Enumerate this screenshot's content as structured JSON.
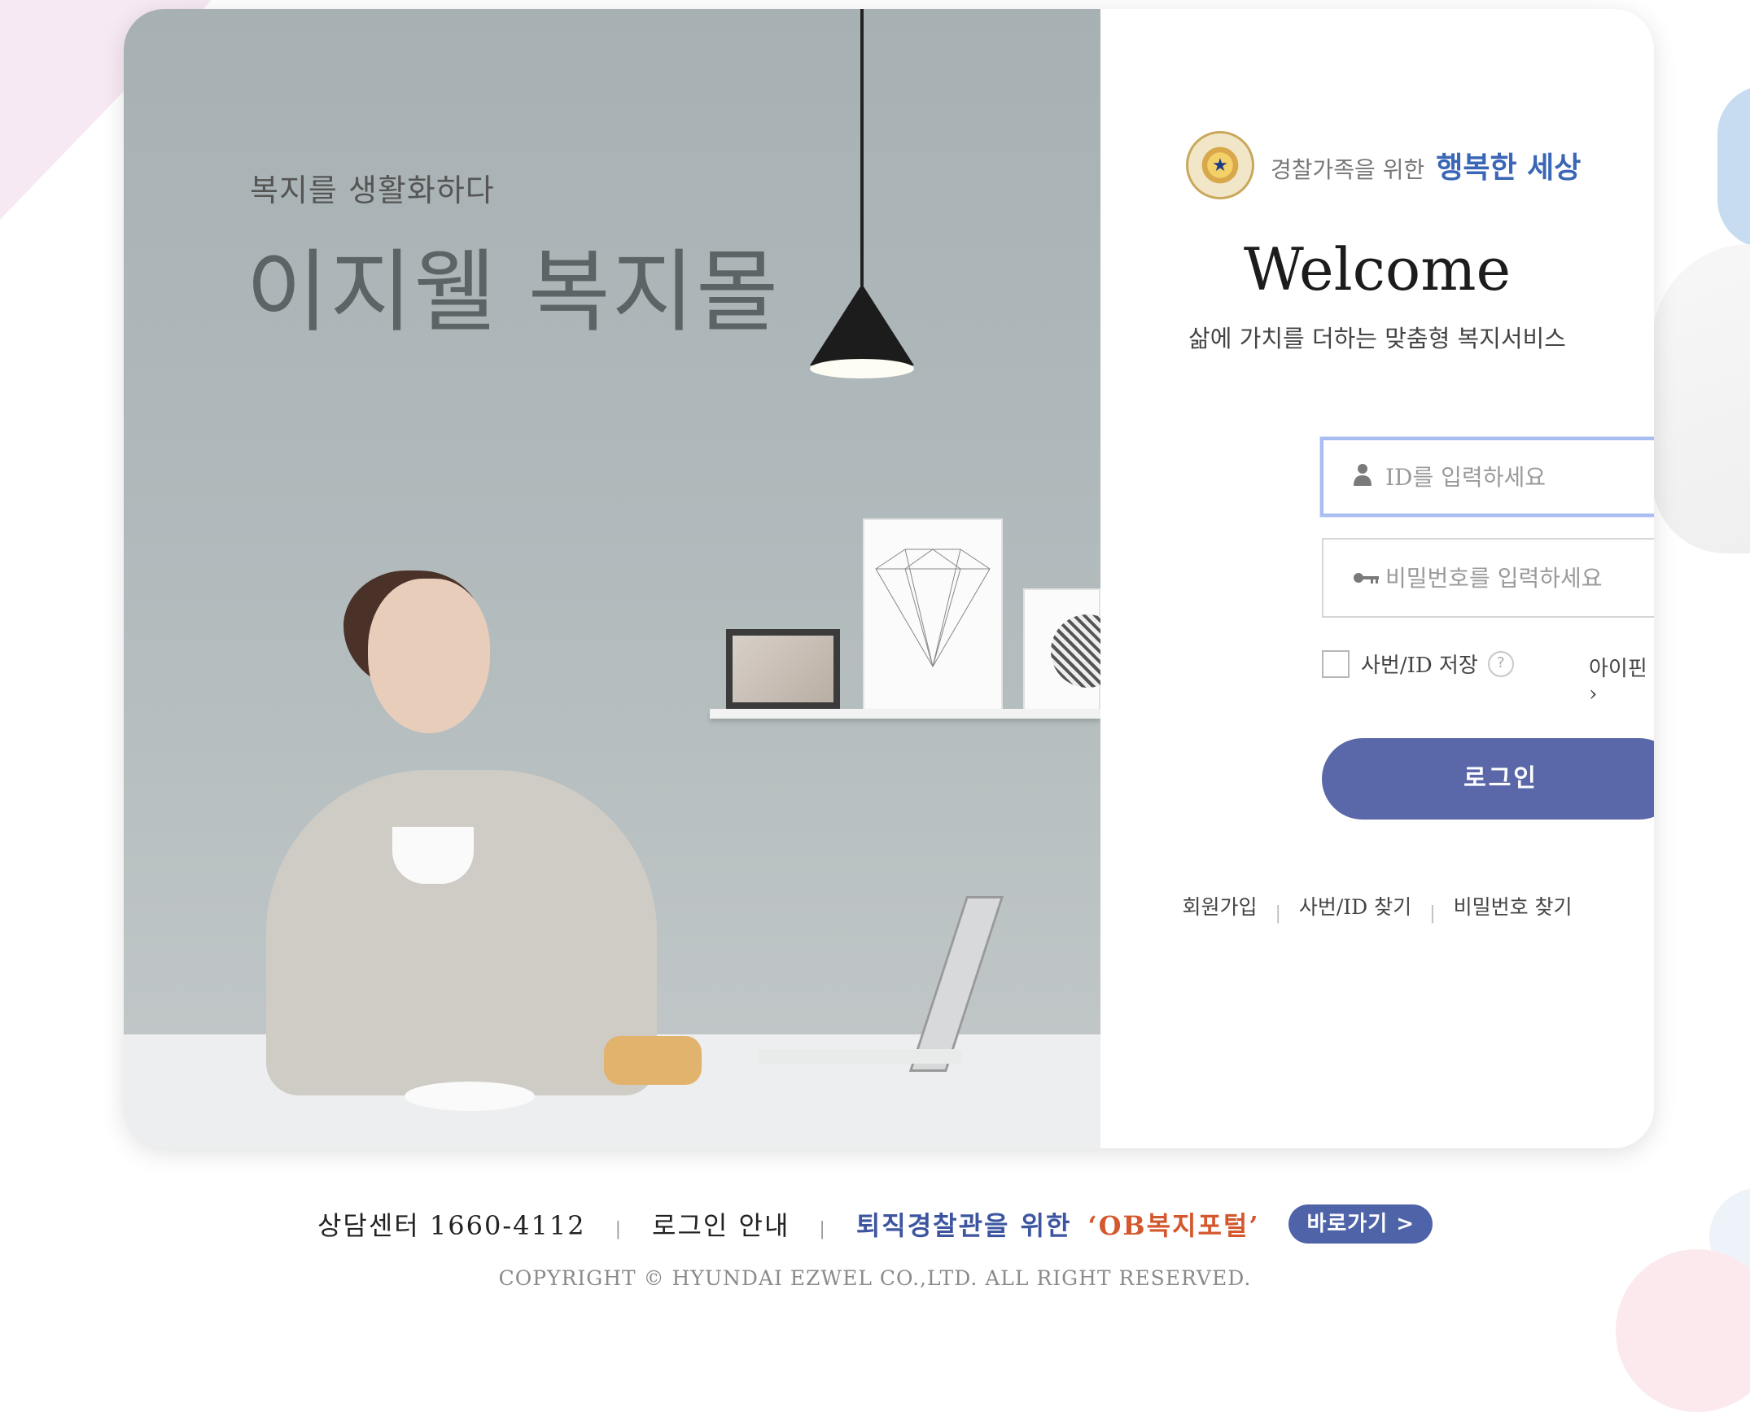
{
  "hero": {
    "tagline": "복지를 생활화하다",
    "headline": "이지웰 복지몰"
  },
  "brand": {
    "emblem_text": "★",
    "subtitle": "경찰가족을 위한",
    "title": "행복한 세상"
  },
  "login": {
    "welcome": "Welcome",
    "welcome_sub": "삶에 가치를 더하는 맞춤형 복지서비스",
    "id_placeholder": "ID를 입력하세요",
    "pw_placeholder": "비밀번호를 입력하세요",
    "remember_label": "사번/ID 저장",
    "help_glyph": "?",
    "ipin_label": "아이핀 ›",
    "submit_label": "로그인",
    "links": {
      "signup": "회원가입",
      "find_id": "사번/ID 찾기",
      "find_pw": "비밀번호 찾기",
      "sep": "|"
    }
  },
  "footer": {
    "consult": "상담센터 1660-4112",
    "login_guide": "로그인 안내",
    "ob_label": "퇴직경찰관을 위한",
    "ob_name": "‘OB복지포털’",
    "go_button": "바로가기 >",
    "sep": "|",
    "copyright": "COPYRIGHT © HYUNDAI EZWEL CO.,LTD. ALL RIGHT RESERVED."
  },
  "colors": {
    "accent": "#5a67a8",
    "brand_blue": "#3a66b5",
    "ob_orange": "#d4582d"
  }
}
